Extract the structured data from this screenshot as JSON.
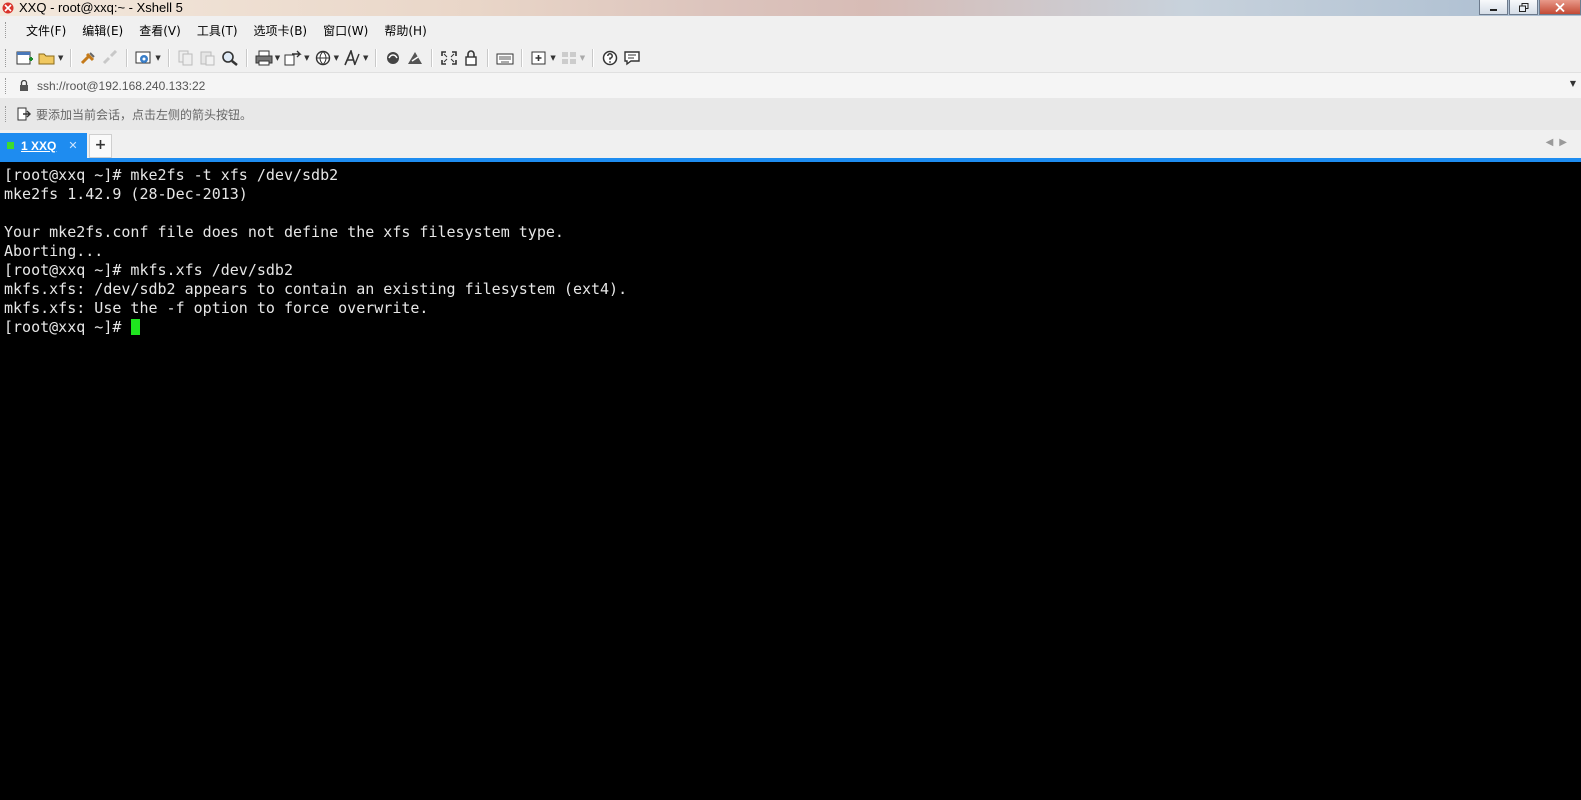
{
  "window": {
    "title": "XXQ - root@xxq:~ - Xshell 5",
    "controls": [
      "minimize",
      "restore",
      "close"
    ]
  },
  "menu": {
    "items": [
      "文件(F)",
      "编辑(E)",
      "查看(V)",
      "工具(T)",
      "选项卡(B)",
      "窗口(W)",
      "帮助(H)"
    ]
  },
  "toolbar": {
    "icons": [
      "new-session-icon",
      "open-folder-icon",
      "connect-icon",
      "disconnect-icon",
      "reconnect-icon",
      "copy-icon",
      "paste-icon",
      "find-icon",
      "print-icon",
      "transfer-icon",
      "globe-icon",
      "font-icon",
      "xftp-icon",
      "xmanager-icon",
      "fullscreen-icon",
      "lock-icon",
      "keyboard-icon",
      "add-icon",
      "layout-icon",
      "help-icon",
      "chat-icon"
    ]
  },
  "address": {
    "value": "ssh://root@192.168.240.133:22"
  },
  "hint": {
    "text": "要添加当前会话，点击左侧的箭头按钮。"
  },
  "tabs": [
    {
      "label": "1 XXQ",
      "active": true,
      "status_color": "#3ddc2e"
    }
  ],
  "terminal": {
    "lines": [
      "[root@xxq ~]# mke2fs -t xfs /dev/sdb2",
      "mke2fs 1.42.9 (28-Dec-2013)",
      "",
      "Your mke2fs.conf file does not define the xfs filesystem type.",
      "Aborting...",
      "[root@xxq ~]# mkfs.xfs /dev/sdb2",
      "mkfs.xfs: /dev/sdb2 appears to contain an existing filesystem (ext4).",
      "mkfs.xfs: Use the -f option to force overwrite."
    ],
    "prompt": "[root@xxq ~]# ",
    "cursor_color": "#1fe51f",
    "background": "#000000",
    "foreground": "#e6e6e6"
  },
  "colors": {
    "tab_accent": "#1e8cf0"
  }
}
